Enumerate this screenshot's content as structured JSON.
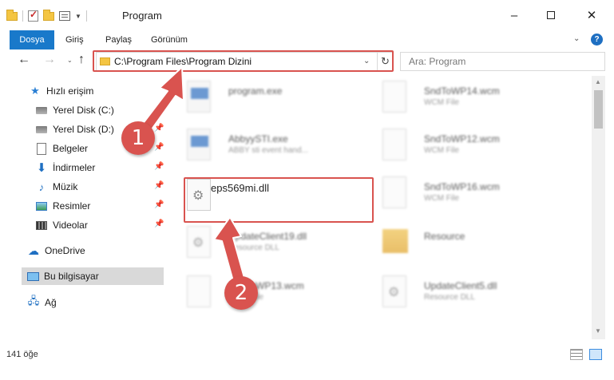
{
  "window": {
    "title": "Program",
    "minimize": "–",
    "close": "✕"
  },
  "ribbon": {
    "tabs": [
      "Dosya",
      "Giriş",
      "Paylaş",
      "Görünüm"
    ],
    "collapse": "⌄",
    "help": "?"
  },
  "navigation": {
    "back": "←",
    "forward": "→",
    "recent": "⌄",
    "up": "↑",
    "address": "C:\\Program Files\\Program Dizini",
    "address_dropdown": "⌄",
    "refresh": "↻",
    "search_placeholder": "Ara: Program"
  },
  "sidebar": {
    "quick_access": "Hızlı erişim",
    "items": [
      {
        "label": "Yerel Disk (C:)",
        "icon": "drive-icon",
        "pinned": true
      },
      {
        "label": "Yerel Disk (D:)",
        "icon": "drive-icon",
        "pinned": true
      },
      {
        "label": "Belgeler",
        "icon": "documents-icon",
        "pinned": true
      },
      {
        "label": "İndirmeler",
        "icon": "downloads-icon",
        "pinned": true
      },
      {
        "label": "Müzik",
        "icon": "music-icon",
        "pinned": true
      },
      {
        "label": "Resimler",
        "icon": "pictures-icon",
        "pinned": true
      },
      {
        "label": "Videolar",
        "icon": "videos-icon",
        "pinned": true
      }
    ],
    "onedrive": "OneDrive",
    "this_pc": "Bu bilgisayar",
    "network": "Ağ",
    "pin_glyph": "📌"
  },
  "files": [
    {
      "name": "program.exe",
      "desc": "",
      "type": "exe"
    },
    {
      "name": "SndToWP14.wcm",
      "desc": "WCM File",
      "type": "doc"
    },
    {
      "name": "AbbyySTI.exe",
      "desc": "ABBY sti event hand...",
      "type": "exe"
    },
    {
      "name": "SndToWP12.wcm",
      "desc": "WCM File",
      "type": "doc"
    },
    {
      "name": "eps569mi.dll",
      "desc": "",
      "type": "dll"
    },
    {
      "name": "SndToWP16.wcm",
      "desc": "WCM File",
      "type": "doc"
    },
    {
      "name": "UpdateClient19.dll",
      "desc": "Resource DLL",
      "type": "dll"
    },
    {
      "name": "Resource",
      "desc": "",
      "type": "folder"
    },
    {
      "name": "SndToWP13.wcm",
      "desc": "WCM File",
      "type": "doc"
    },
    {
      "name": "UpdateClient5.dll",
      "desc": "Resource DLL",
      "type": "dll"
    }
  ],
  "status": {
    "item_count": "141 öğe"
  },
  "annotations": {
    "step1": "1",
    "step2": "2",
    "color": "#d9534f"
  }
}
